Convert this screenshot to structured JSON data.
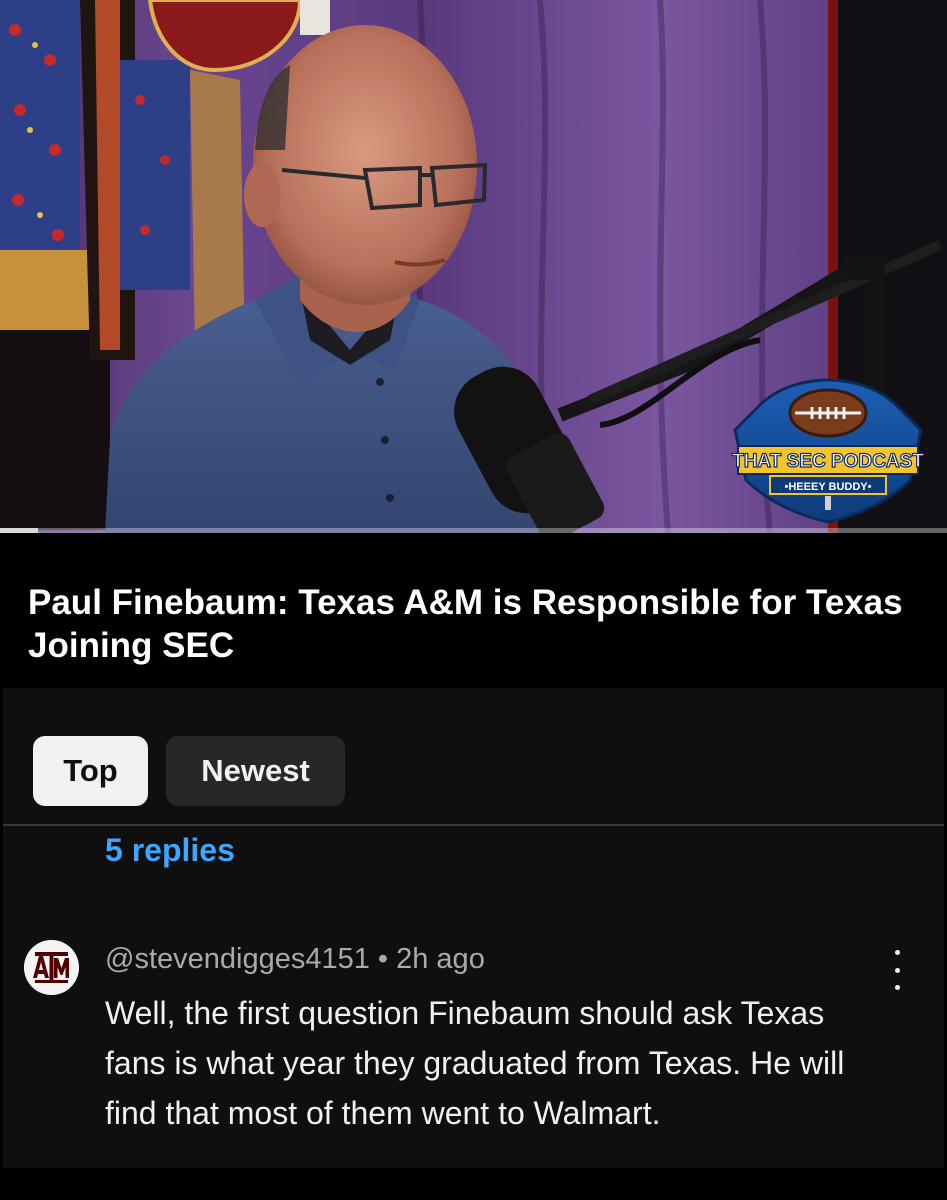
{
  "video": {
    "logo": {
      "line1": "THAT SEC PODCAST",
      "line2": "•HEEEY BUDDY•"
    },
    "progress": 0.04
  },
  "title": "Paul Finebaum: Texas A&M is Responsible for Texas Joining SEC",
  "comments": {
    "sort_tabs": {
      "top_label": "Top",
      "newest_label": "Newest",
      "selected": "Top"
    },
    "replies_label": "5 replies",
    "comment": {
      "avatar_text": "ATM",
      "author": "@stevendigges4151",
      "time": "2h ago",
      "meta": "@stevendigges4151 • 2h ago",
      "text": "Well, the first question Finebaum should ask Texas fans is what year they graduated from Texas. He will find that most of them went to Walmart."
    }
  },
  "colors": {
    "accent_link": "#3ea6ff",
    "panel_bg": "#0f0f0f",
    "chip_selected_bg": "#f1f1f1",
    "chip_bg": "#272727",
    "aggie_maroon": "#500000"
  }
}
